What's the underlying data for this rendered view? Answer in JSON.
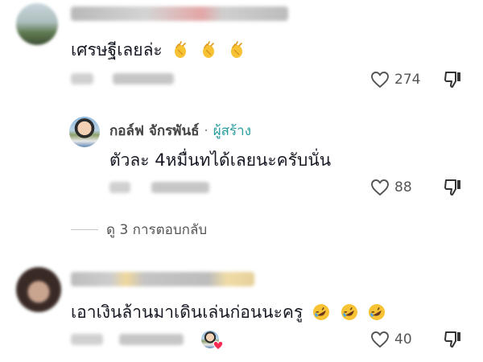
{
  "comments": [
    {
      "username": "",
      "text": "เศรษฐีเลยล่ะ",
      "emoji": "clapping-hands",
      "emoji_count": 3,
      "likes": "274"
    },
    {
      "username": "กอล์ฟ  จักรพันธ์",
      "separator": "·",
      "creator_tag": "ผู้สร้าง",
      "text": "ตัวละ 4หมื่นทได้เลยนะครับนั่น",
      "likes": "88",
      "is_reply": true
    },
    {
      "username": "",
      "text": "เอาเงินล้านมาเดินเล่นก่อนนะครู",
      "emoji": "rolling-on-floor-laughing",
      "emoji_count": 3,
      "likes": "40",
      "creator_liked": true
    }
  ],
  "view_replies": "ดู 3 การตอบกลับ",
  "icons": {
    "like": "heart-outline-icon",
    "dislike": "thumbs-down-icon",
    "creator_liked": "heart-filled-icon"
  },
  "colors": {
    "creator_tag": "#2a9d9f",
    "heart_red": "#fe2c55",
    "emoji_yellow": "#f7c335"
  }
}
